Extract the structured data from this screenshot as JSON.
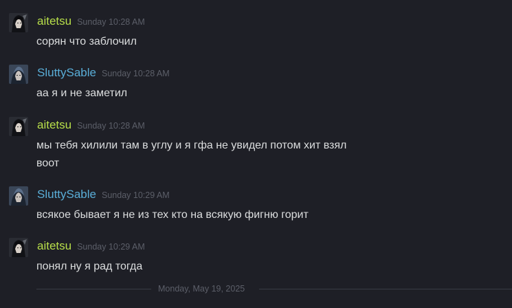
{
  "messages": [
    {
      "author": "aitetsu",
      "status": "ingame",
      "time": "Sunday 10:28 AM",
      "lines": [
        "сорян что заблочил"
      ]
    },
    {
      "author": "SluttySable",
      "status": "online",
      "time": "Sunday 10:28 AM",
      "lines": [
        "аа я и не заметил"
      ]
    },
    {
      "author": "aitetsu",
      "status": "ingame",
      "time": "Sunday 10:28 AM",
      "lines": [
        "мы тебя хилили там в углу и я гфа не увидел потом хит взял",
        "воот"
      ]
    },
    {
      "author": "SluttySable",
      "status": "online",
      "time": "Sunday 10:29 AM",
      "lines": [
        "всякое бывает я не из тех кто на всякую фигню горит"
      ]
    },
    {
      "author": "aitetsu",
      "status": "ingame",
      "time": "Sunday 10:29 AM",
      "lines": [
        "понял ну я рад тогда"
      ]
    }
  ],
  "date_divider": "Monday, May 19, 2025",
  "colors": {
    "background": "#1e1f26",
    "ingame_name": "#b8df4a",
    "online_name": "#5aaed8",
    "message_text": "#dcdedf",
    "timestamp": "#5c5f69"
  }
}
